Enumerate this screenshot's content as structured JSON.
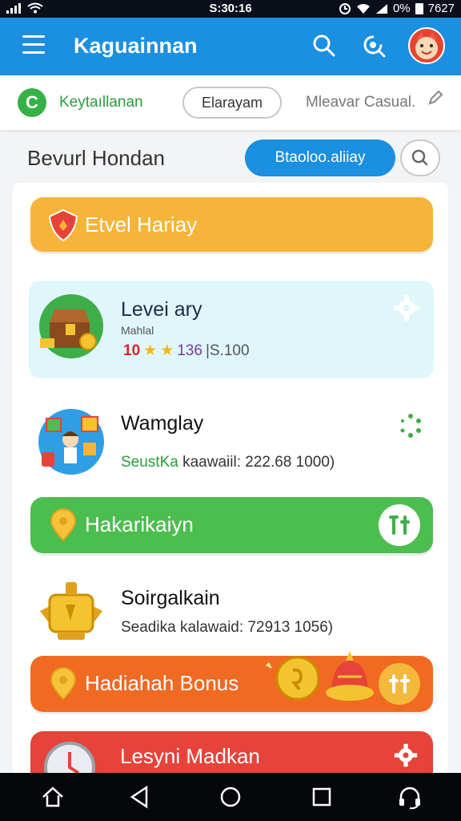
{
  "status_bar": {
    "time": "S:30:16",
    "battery": "0%",
    "clock_right": "7627"
  },
  "app_bar": {
    "title": "Kaguainnan"
  },
  "filter_bar": {
    "brand_letter": "C",
    "brand_text": "Keytaıllanan",
    "chip_label": "Elarayam",
    "casual_link": "Mleavar Casual."
  },
  "section": {
    "title": "Bevurl Hondan",
    "pill_button": "Btaoloo.aliiay"
  },
  "banners": {
    "level": "Etvel Hariay",
    "hakari": "Hakarikaiyn",
    "bonus": "Hadiahah Bonus",
    "lesyni": "Lesyni Madkan"
  },
  "cards": [
    {
      "title": "Levei ary",
      "tag": "Mahlal",
      "rating": "10",
      "ratings_count": "136",
      "plays": "|S.100"
    },
    {
      "title": "Wamglay",
      "sub_highlight": "SeustKa",
      "sub_rest": " kaawaiil: 222.68 1000)"
    },
    {
      "title": "Soirgalkain",
      "sub": "Seadika kalawaid: 72913 1056)"
    }
  ],
  "colors": {
    "primary": "#1b8fe0",
    "level_banner": "#f6b43a",
    "hakari_banner": "#4cbd4f",
    "bonus_banner": "#f06a22",
    "lesyni_banner": "#e6433a",
    "card_highlight": "#dff7fa"
  },
  "icons": [
    "menu-icon",
    "search-icon",
    "refresh-icon",
    "avatar",
    "pen-icon",
    "gear-icon",
    "loading-icon",
    "tools-icon",
    "home-icon",
    "back-icon",
    "circle-home-icon",
    "recents-icon",
    "headset-icon"
  ]
}
